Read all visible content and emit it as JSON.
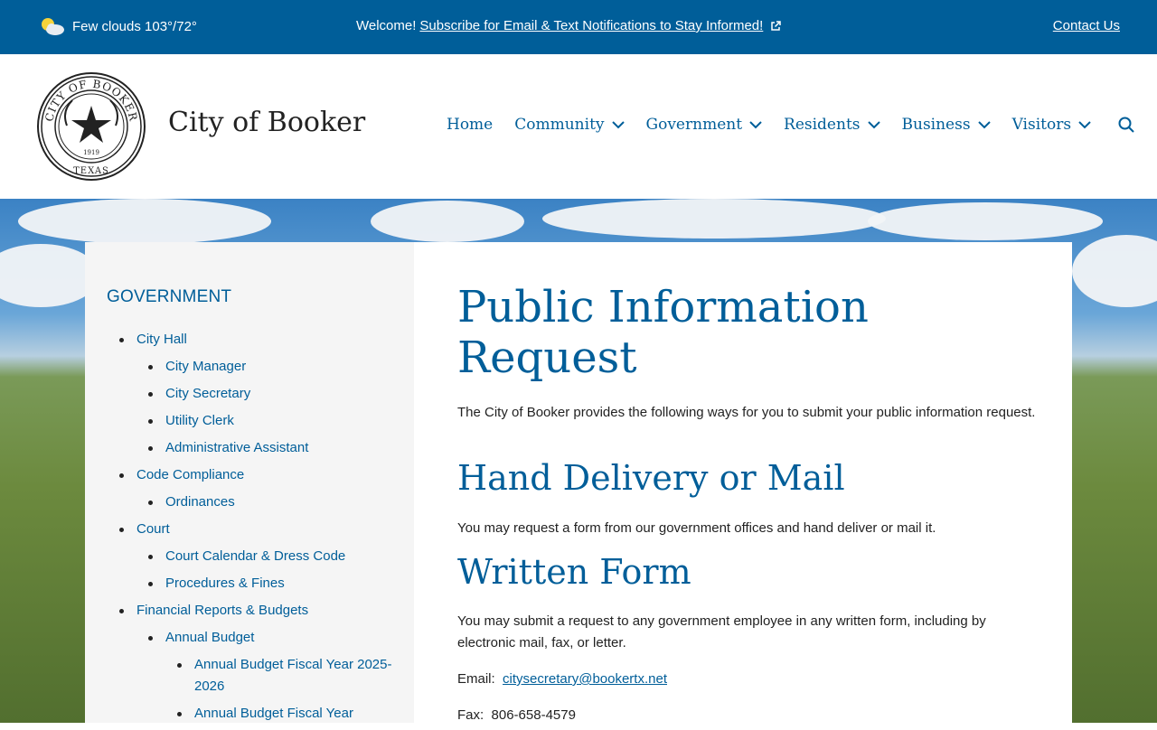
{
  "topbar": {
    "weather": "Few clouds 103°/72°",
    "welcome_prefix": "Welcome!",
    "welcome_link": "Subscribe for Email & Text Notifications to Stay Informed!",
    "contact": "Contact Us"
  },
  "header": {
    "site_title": "City of Booker",
    "seal_text_top": "CITY OF BOOKER",
    "seal_year": "1919",
    "seal_text_bottom": "TEXAS",
    "nav": [
      {
        "label": "Home",
        "has_dropdown": false
      },
      {
        "label": "Community",
        "has_dropdown": true
      },
      {
        "label": "Government",
        "has_dropdown": true
      },
      {
        "label": "Residents",
        "has_dropdown": true
      },
      {
        "label": "Business",
        "has_dropdown": true
      },
      {
        "label": "Visitors",
        "has_dropdown": true
      }
    ]
  },
  "sidebar": {
    "title": "GOVERNMENT",
    "items": [
      {
        "label": "City Hall",
        "level": 1
      },
      {
        "label": "City Manager",
        "level": 2
      },
      {
        "label": "City Secretary",
        "level": 2
      },
      {
        "label": "Utility Clerk",
        "level": 2
      },
      {
        "label": "Administrative Assistant",
        "level": 2
      },
      {
        "label": "Code Compliance",
        "level": 1
      },
      {
        "label": "Ordinances",
        "level": 2
      },
      {
        "label": "Court",
        "level": 1
      },
      {
        "label": "Court Calendar & Dress Code",
        "level": 2
      },
      {
        "label": "Procedures & Fines",
        "level": 2
      },
      {
        "label": "Financial Reports & Budgets",
        "level": 1
      },
      {
        "label": "Annual Budget",
        "level": 2
      },
      {
        "label": "Annual Budget Fiscal Year 2025-2026",
        "level": 3
      },
      {
        "label": "Annual Budget Fiscal Year",
        "level": 3
      }
    ]
  },
  "main": {
    "title": "Public Information Request",
    "intro": "The City of Booker provides the following ways for you to submit your public information request.",
    "section1_title": "Hand Delivery or Mail",
    "section1_text": "You may request a form from our government offices and hand deliver or mail it.",
    "section2_title": "Written Form",
    "section2_text": "You may submit a request to any government employee in any written form, including by electronic mail, fax, or letter.",
    "email_label": "Email:",
    "email_value": "citysecretary@bookertx.net",
    "fax_label": "Fax:",
    "fax_value": "806-658-4579"
  },
  "colors": {
    "brand_blue": "#005e99",
    "sidebar_bg": "#f5f5f5",
    "text": "#222222"
  }
}
